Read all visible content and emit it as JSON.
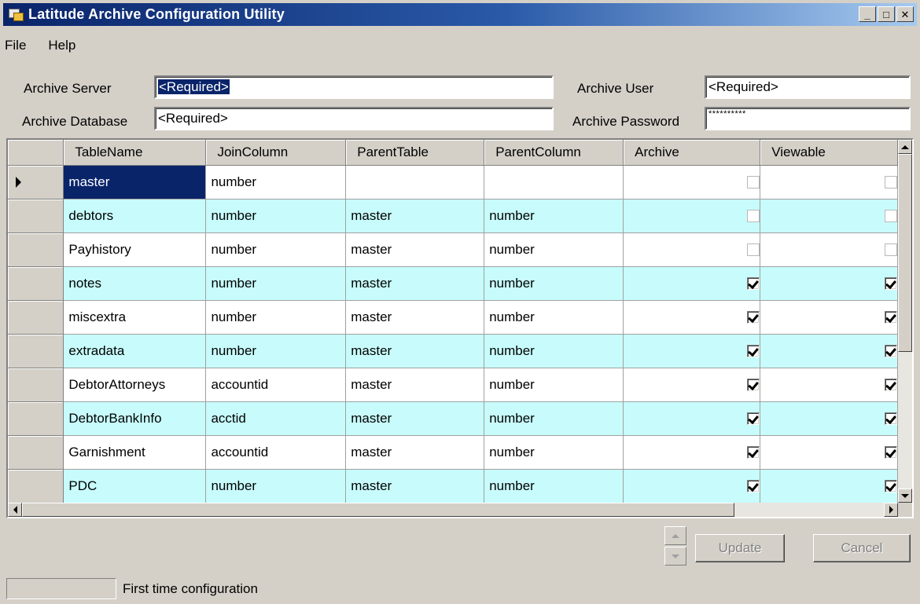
{
  "window": {
    "title": "Latitude Archive Configuration Utility"
  },
  "title_buttons": {
    "minimize": "_",
    "maximize": "□",
    "close": "✕"
  },
  "menu": {
    "items": [
      "File",
      "Help"
    ]
  },
  "form": {
    "archive_server_label": "Archive Server",
    "archive_server_value": "<Required>",
    "archive_database_label": "Archive Database",
    "archive_database_value": "<Required>",
    "archive_user_label": "Archive User",
    "archive_user_value": "<Required>",
    "archive_password_label": "Archive Password",
    "archive_password_value": "**********"
  },
  "grid": {
    "columns": [
      "TableName",
      "JoinColumn",
      "ParentTable",
      "ParentColumn",
      "Archive",
      "Viewable"
    ],
    "rows": [
      {
        "table": "master",
        "join": "number",
        "parent_table": "",
        "parent_column": "",
        "archive": false,
        "viewable": false
      },
      {
        "table": "debtors",
        "join": "number",
        "parent_table": "master",
        "parent_column": "number",
        "archive": false,
        "viewable": false
      },
      {
        "table": "Payhistory",
        "join": "number",
        "parent_table": "master",
        "parent_column": "number",
        "archive": false,
        "viewable": false
      },
      {
        "table": "notes",
        "join": "number",
        "parent_table": "master",
        "parent_column": "number",
        "archive": true,
        "viewable": true
      },
      {
        "table": "miscextra",
        "join": "number",
        "parent_table": "master",
        "parent_column": "number",
        "archive": true,
        "viewable": true
      },
      {
        "table": "extradata",
        "join": "number",
        "parent_table": "master",
        "parent_column": "number",
        "archive": true,
        "viewable": true
      },
      {
        "table": "DebtorAttorneys",
        "join": "accountid",
        "parent_table": "master",
        "parent_column": "number",
        "archive": true,
        "viewable": true
      },
      {
        "table": "DebtorBankInfo",
        "join": "acctid",
        "parent_table": "master",
        "parent_column": "number",
        "archive": true,
        "viewable": true
      },
      {
        "table": "Garnishment",
        "join": "accountid",
        "parent_table": "master",
        "parent_column": "number",
        "archive": true,
        "viewable": true
      },
      {
        "table": "PDC",
        "join": "number",
        "parent_table": "master",
        "parent_column": "number",
        "archive": true,
        "viewable": true
      }
    ]
  },
  "buttons": {
    "update": "Update",
    "cancel": "Cancel"
  },
  "status": {
    "text": "First time configuration"
  }
}
